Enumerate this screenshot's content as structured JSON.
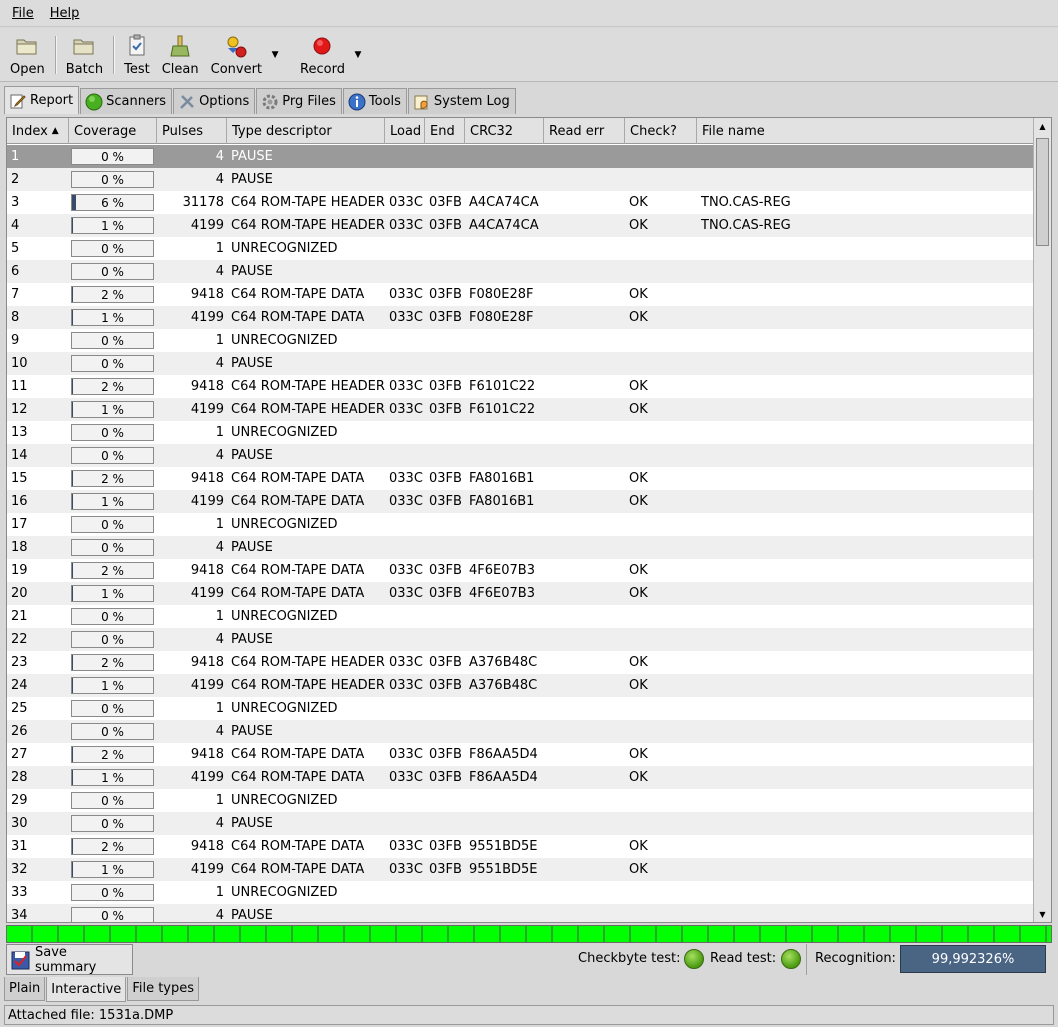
{
  "menu": {
    "file": "File",
    "help": "Help"
  },
  "toolbar": {
    "open": "Open",
    "batch": "Batch",
    "test": "Test",
    "clean": "Clean",
    "convert": "Convert",
    "record": "Record"
  },
  "tabs": [
    {
      "label": "Report",
      "icon": "pencil-note-icon"
    },
    {
      "label": "Scanners",
      "icon": "green-circle-icon"
    },
    {
      "label": "Options",
      "icon": "tools-icon"
    },
    {
      "label": "Prg Files",
      "icon": "gear-icon"
    },
    {
      "label": "Tools",
      "icon": "info-icon"
    },
    {
      "label": "System Log",
      "icon": "log-hand-icon"
    }
  ],
  "columns": [
    "Index",
    "Coverage",
    "Pulses",
    "Type descriptor",
    "Load",
    "End",
    "CRC32",
    "Read err",
    "Check?",
    "File name"
  ],
  "rows": [
    {
      "index": "1",
      "coverage": "0 %",
      "cov": 0,
      "pulses": "4",
      "type": "PAUSE",
      "load": "",
      "end": "",
      "crc": "",
      "err": "",
      "check": "",
      "file": ""
    },
    {
      "index": "2",
      "coverage": "0 %",
      "cov": 0,
      "pulses": "4",
      "type": "PAUSE",
      "load": "",
      "end": "",
      "crc": "",
      "err": "",
      "check": "",
      "file": ""
    },
    {
      "index": "3",
      "coverage": "6 %",
      "cov": 6,
      "pulses": "31178",
      "type": "C64 ROM-TAPE HEADER",
      "load": "033C",
      "end": "03FB",
      "crc": "A4CA74CA",
      "err": "",
      "check": "OK",
      "file": "TNO.CAS-REG"
    },
    {
      "index": "4",
      "coverage": "1 %",
      "cov": 1,
      "pulses": "4199",
      "type": "C64 ROM-TAPE HEADER",
      "load": "033C",
      "end": "03FB",
      "crc": "A4CA74CA",
      "err": "",
      "check": "OK",
      "file": "TNO.CAS-REG"
    },
    {
      "index": "5",
      "coverage": "0 %",
      "cov": 0,
      "pulses": "1",
      "type": "UNRECOGNIZED",
      "load": "",
      "end": "",
      "crc": "",
      "err": "",
      "check": "",
      "file": ""
    },
    {
      "index": "6",
      "coverage": "0 %",
      "cov": 0,
      "pulses": "4",
      "type": "PAUSE",
      "load": "",
      "end": "",
      "crc": "",
      "err": "",
      "check": "",
      "file": ""
    },
    {
      "index": "7",
      "coverage": "2 %",
      "cov": 2,
      "pulses": "9418",
      "type": "C64 ROM-TAPE DATA",
      "load": "033C",
      "end": "03FB",
      "crc": "F080E28F",
      "err": "",
      "check": "OK",
      "file": ""
    },
    {
      "index": "8",
      "coverage": "1 %",
      "cov": 1,
      "pulses": "4199",
      "type": "C64 ROM-TAPE DATA",
      "load": "033C",
      "end": "03FB",
      "crc": "F080E28F",
      "err": "",
      "check": "OK",
      "file": ""
    },
    {
      "index": "9",
      "coverage": "0 %",
      "cov": 0,
      "pulses": "1",
      "type": "UNRECOGNIZED",
      "load": "",
      "end": "",
      "crc": "",
      "err": "",
      "check": "",
      "file": ""
    },
    {
      "index": "10",
      "coverage": "0 %",
      "cov": 0,
      "pulses": "4",
      "type": "PAUSE",
      "load": "",
      "end": "",
      "crc": "",
      "err": "",
      "check": "",
      "file": ""
    },
    {
      "index": "11",
      "coverage": "2 %",
      "cov": 2,
      "pulses": "9418",
      "type": "C64 ROM-TAPE HEADER",
      "load": "033C",
      "end": "03FB",
      "crc": "F6101C22",
      "err": "",
      "check": "OK",
      "file": ""
    },
    {
      "index": "12",
      "coverage": "1 %",
      "cov": 1,
      "pulses": "4199",
      "type": "C64 ROM-TAPE HEADER",
      "load": "033C",
      "end": "03FB",
      "crc": "F6101C22",
      "err": "",
      "check": "OK",
      "file": ""
    },
    {
      "index": "13",
      "coverage": "0 %",
      "cov": 0,
      "pulses": "1",
      "type": "UNRECOGNIZED",
      "load": "",
      "end": "",
      "crc": "",
      "err": "",
      "check": "",
      "file": ""
    },
    {
      "index": "14",
      "coverage": "0 %",
      "cov": 0,
      "pulses": "4",
      "type": "PAUSE",
      "load": "",
      "end": "",
      "crc": "",
      "err": "",
      "check": "",
      "file": ""
    },
    {
      "index": "15",
      "coverage": "2 %",
      "cov": 2,
      "pulses": "9418",
      "type": "C64 ROM-TAPE DATA",
      "load": "033C",
      "end": "03FB",
      "crc": "FA8016B1",
      "err": "",
      "check": "OK",
      "file": ""
    },
    {
      "index": "16",
      "coverage": "1 %",
      "cov": 1,
      "pulses": "4199",
      "type": "C64 ROM-TAPE DATA",
      "load": "033C",
      "end": "03FB",
      "crc": "FA8016B1",
      "err": "",
      "check": "OK",
      "file": ""
    },
    {
      "index": "17",
      "coverage": "0 %",
      "cov": 0,
      "pulses": "1",
      "type": "UNRECOGNIZED",
      "load": "",
      "end": "",
      "crc": "",
      "err": "",
      "check": "",
      "file": ""
    },
    {
      "index": "18",
      "coverage": "0 %",
      "cov": 0,
      "pulses": "4",
      "type": "PAUSE",
      "load": "",
      "end": "",
      "crc": "",
      "err": "",
      "check": "",
      "file": ""
    },
    {
      "index": "19",
      "coverage": "2 %",
      "cov": 2,
      "pulses": "9418",
      "type": "C64 ROM-TAPE DATA",
      "load": "033C",
      "end": "03FB",
      "crc": "4F6E07B3",
      "err": "",
      "check": "OK",
      "file": ""
    },
    {
      "index": "20",
      "coverage": "1 %",
      "cov": 1,
      "pulses": "4199",
      "type": "C64 ROM-TAPE DATA",
      "load": "033C",
      "end": "03FB",
      "crc": "4F6E07B3",
      "err": "",
      "check": "OK",
      "file": ""
    },
    {
      "index": "21",
      "coverage": "0 %",
      "cov": 0,
      "pulses": "1",
      "type": "UNRECOGNIZED",
      "load": "",
      "end": "",
      "crc": "",
      "err": "",
      "check": "",
      "file": ""
    },
    {
      "index": "22",
      "coverage": "0 %",
      "cov": 0,
      "pulses": "4",
      "type": "PAUSE",
      "load": "",
      "end": "",
      "crc": "",
      "err": "",
      "check": "",
      "file": ""
    },
    {
      "index": "23",
      "coverage": "2 %",
      "cov": 2,
      "pulses": "9418",
      "type": "C64 ROM-TAPE HEADER",
      "load": "033C",
      "end": "03FB",
      "crc": "A376B48C",
      "err": "",
      "check": "OK",
      "file": ""
    },
    {
      "index": "24",
      "coverage": "1 %",
      "cov": 1,
      "pulses": "4199",
      "type": "C64 ROM-TAPE HEADER",
      "load": "033C",
      "end": "03FB",
      "crc": "A376B48C",
      "err": "",
      "check": "OK",
      "file": ""
    },
    {
      "index": "25",
      "coverage": "0 %",
      "cov": 0,
      "pulses": "1",
      "type": "UNRECOGNIZED",
      "load": "",
      "end": "",
      "crc": "",
      "err": "",
      "check": "",
      "file": ""
    },
    {
      "index": "26",
      "coverage": "0 %",
      "cov": 0,
      "pulses": "4",
      "type": "PAUSE",
      "load": "",
      "end": "",
      "crc": "",
      "err": "",
      "check": "",
      "file": ""
    },
    {
      "index": "27",
      "coverage": "2 %",
      "cov": 2,
      "pulses": "9418",
      "type": "C64 ROM-TAPE DATA",
      "load": "033C",
      "end": "03FB",
      "crc": "F86AA5D4",
      "err": "",
      "check": "OK",
      "file": ""
    },
    {
      "index": "28",
      "coverage": "1 %",
      "cov": 1,
      "pulses": "4199",
      "type": "C64 ROM-TAPE DATA",
      "load": "033C",
      "end": "03FB",
      "crc": "F86AA5D4",
      "err": "",
      "check": "OK",
      "file": ""
    },
    {
      "index": "29",
      "coverage": "0 %",
      "cov": 0,
      "pulses": "1",
      "type": "UNRECOGNIZED",
      "load": "",
      "end": "",
      "crc": "",
      "err": "",
      "check": "",
      "file": ""
    },
    {
      "index": "30",
      "coverage": "0 %",
      "cov": 0,
      "pulses": "4",
      "type": "PAUSE",
      "load": "",
      "end": "",
      "crc": "",
      "err": "",
      "check": "",
      "file": ""
    },
    {
      "index": "31",
      "coverage": "2 %",
      "cov": 2,
      "pulses": "9418",
      "type": "C64 ROM-TAPE DATA",
      "load": "033C",
      "end": "03FB",
      "crc": "9551BD5E",
      "err": "",
      "check": "OK",
      "file": ""
    },
    {
      "index": "32",
      "coverage": "1 %",
      "cov": 1,
      "pulses": "4199",
      "type": "C64 ROM-TAPE DATA",
      "load": "033C",
      "end": "03FB",
      "crc": "9551BD5E",
      "err": "",
      "check": "OK",
      "file": ""
    },
    {
      "index": "33",
      "coverage": "0 %",
      "cov": 0,
      "pulses": "1",
      "type": "UNRECOGNIZED",
      "load": "",
      "end": "",
      "crc": "",
      "err": "",
      "check": "",
      "file": ""
    },
    {
      "index": "34",
      "coverage": "0 %",
      "cov": 0,
      "pulses": "4",
      "type": "PAUSE",
      "load": "",
      "end": "",
      "crc": "",
      "err": "",
      "check": "",
      "file": ""
    }
  ],
  "summary": {
    "save_summary": "Save summary",
    "checkbyte_label": "Checkbyte test:",
    "readtest_label": "Read test:",
    "recognition_label": "Recognition:",
    "recognition_value": "99,992326%"
  },
  "bottom_tabs": [
    "Plain",
    "Interactive",
    "File types"
  ],
  "status": {
    "text": "Attached file: 1531a.DMP"
  },
  "colors": {
    "selected_row": "#9a9a9a",
    "recognition_bg": "#4a6484",
    "green_strip": "#00ff00"
  }
}
